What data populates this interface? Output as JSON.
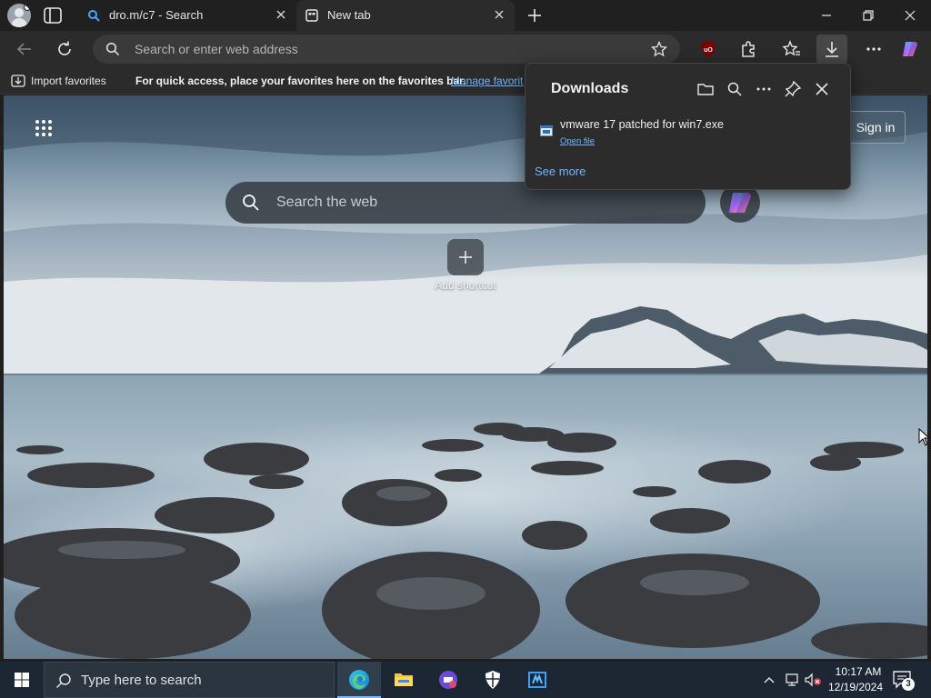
{
  "tabs": [
    {
      "title": "dro.m/c7 - Search",
      "active": false,
      "favicon": "bing-search-icon"
    },
    {
      "title": "New tab",
      "active": true,
      "favicon": "newtab-icon"
    }
  ],
  "toolbar": {
    "address_placeholder": "Search or enter web address"
  },
  "favorites_bar": {
    "import_label": "Import favorites",
    "message": "For quick access, place your favorites here on the favorites bar.",
    "manage_link": "Manage favorites"
  },
  "new_tab": {
    "search_placeholder": "Search the web",
    "sign_in_label": "Sign in",
    "add_shortcut_label": "Add shortcut"
  },
  "downloads": {
    "title": "Downloads",
    "items": [
      {
        "file_name": "vmware 17 patched for win7.exe",
        "action": "Open file"
      }
    ],
    "see_more": "See more"
  },
  "taskbar": {
    "search_placeholder": "Type here to search",
    "time": "10:17 AM",
    "date": "12/19/2024",
    "notification_count": "3",
    "apps": [
      "edge-icon",
      "file-explorer-icon",
      "media-app-icon",
      "defender-icon",
      "virtualization-app-icon"
    ]
  },
  "colors": {
    "accent": "#6fb6ff",
    "chrome_dark": "#202020",
    "toolbar": "#2b2b2b",
    "taskbar": "#1c2733"
  }
}
